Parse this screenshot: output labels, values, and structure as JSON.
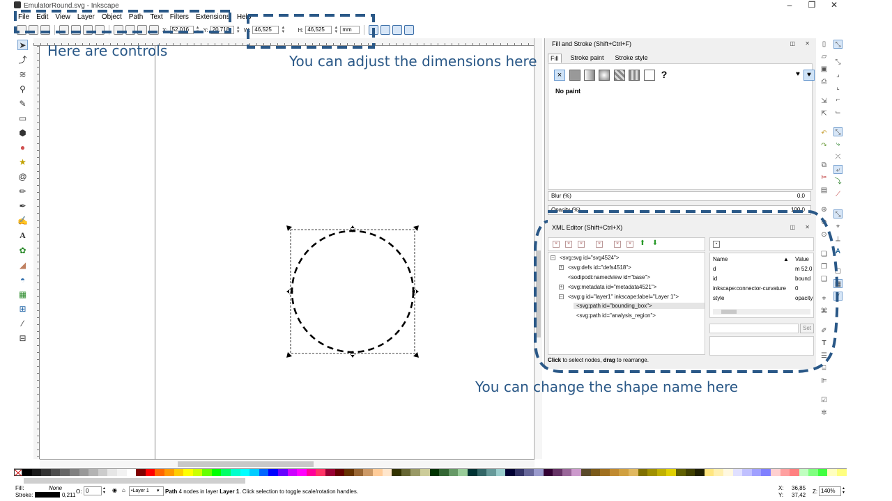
{
  "window": {
    "title": "EmulatorRound.svg - Inkscape",
    "controls": [
      "–",
      "❐",
      "✕"
    ]
  },
  "menu": [
    "File",
    "Edit",
    "View",
    "Layer",
    "Object",
    "Path",
    "Text",
    "Filters",
    "Extensions",
    "Help"
  ],
  "controls_bar": {
    "x_label": "X:",
    "x_value": "52,016",
    "y_label": "Y:",
    "y_value": "20,718",
    "w_label": "W:",
    "w_value": "46,525",
    "h_label": "H:",
    "h_value": "46,525",
    "unit": "mm"
  },
  "tools": [
    "select",
    "node",
    "tweak",
    "zoom",
    "measure",
    "rectangle",
    "3d-box",
    "ellipse",
    "star",
    "spiral",
    "pencil",
    "pen",
    "calligraphy",
    "text",
    "spray",
    "eraser",
    "paint-bucket",
    "gradient",
    "mesh",
    "dropper",
    "connector"
  ],
  "fill_stroke": {
    "title": "Fill and Stroke (Shift+Ctrl+F)",
    "tabs": [
      "Fill",
      "Stroke paint",
      "Stroke style"
    ],
    "paint_glyphs": [
      "×",
      "?"
    ],
    "no_paint_label": "No paint",
    "blur_label": "Blur (%)",
    "blur_value": "0,0",
    "opacity_label": "Opacity (%)",
    "opacity_value": "100,0"
  },
  "xml_editor": {
    "title": "XML Editor (Shift+Ctrl+X)",
    "nodes": [
      "<svg:svg id=\"svg4524\">",
      "<svg:defs id=\"defs4518\">",
      "<sodipodi:namedview id=\"base\">",
      "<svg:metadata id=\"metadata4521\">",
      "<svg:g id=\"layer1\" inkscape:label=\"Layer 1\">",
      "<svg:path id=\"bounding_box\">",
      "<svg:path id=\"analysis_region\">"
    ],
    "attr_headers": [
      "Name",
      "Value"
    ],
    "attributes": [
      {
        "name": "d",
        "value": "m 52.0"
      },
      {
        "name": "id",
        "value": "bound"
      },
      {
        "name": "inkscape:connector-curvature",
        "value": "0"
      },
      {
        "name": "style",
        "value": "opacity"
      }
    ],
    "set_label": "Set",
    "status_bold1": "Click",
    "status_mid": " to select nodes, ",
    "status_bold2": "drag",
    "status_end": " to rearrange."
  },
  "status_bar": {
    "fill_label": "Fill:",
    "fill_value": "None",
    "stroke_label": "Stroke:",
    "stroke_width": "0,211",
    "opacity_label": "O:",
    "opacity_value": "0",
    "layer": "•Layer 1",
    "message_bold": "Path",
    "message": " 4 nodes in layer ",
    "message_layer": "Layer 1",
    "message_end": ". Click selection to toggle scale/rotation handles.",
    "x_label": "X:",
    "x_value": "36,85",
    "y_label": "Y:",
    "y_value": "37,42",
    "zoom_label": "Z:",
    "zoom_value": "140%"
  },
  "annotations": {
    "controls": "Here are controls",
    "dimensions": "You can adjust the dimensions here",
    "shape_name": "You can change the shape name here"
  },
  "colors": {
    "annotation": "#2a5887",
    "selected_tool_bg": "#dbe8f6",
    "palette": [
      "#000000",
      "#1a1a1a",
      "#333333",
      "#4d4d4d",
      "#666666",
      "#808080",
      "#999999",
      "#b3b3b3",
      "#cccccc",
      "#e6e6e6",
      "#f2f2f2",
      "#ffffff",
      "#800000",
      "#ff0000",
      "#ff6600",
      "#ff9900",
      "#ffcc00",
      "#ffff00",
      "#ccff00",
      "#66ff00",
      "#00ff00",
      "#00ff66",
      "#00ffcc",
      "#00ffff",
      "#00ccff",
      "#0066ff",
      "#0000ff",
      "#6600ff",
      "#cc00ff",
      "#ff00ff",
      "#ff0099",
      "#ff3366",
      "#990033",
      "#660000",
      "#663300",
      "#996633",
      "#cc9966",
      "#ffcc99",
      "#ffe6cc",
      "#333300",
      "#666633",
      "#999966",
      "#cccc99",
      "#003300",
      "#336633",
      "#669966",
      "#99cc99",
      "#003333",
      "#336666",
      "#669999",
      "#99cccc",
      "#000033",
      "#333366",
      "#666699",
      "#9999cc",
      "#330033",
      "#663366",
      "#996699",
      "#cc99cc",
      "#5a4a2a",
      "#7a5a1a",
      "#a07020",
      "#c08a30",
      "#d0a040",
      "#e0b860",
      "#807000",
      "#a09000",
      "#c0b000",
      "#e0d000",
      "#606000",
      "#404000",
      "#202000",
      "#ffe680",
      "#fff0b0",
      "#fff8e0",
      "#e0e0ff",
      "#c0c0ff",
      "#a0a0ff",
      "#8080ff",
      "#ffd0d0",
      "#ffa0a0",
      "#ff8080",
      "#c0ffc0",
      "#80ff80",
      "#40ff40",
      "#ffffc0",
      "#ffff80"
    ]
  }
}
